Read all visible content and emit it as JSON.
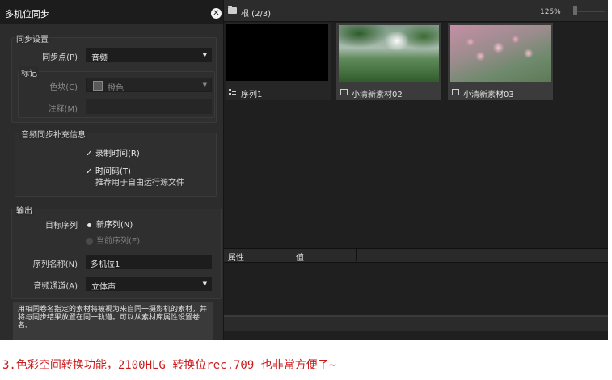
{
  "dialog": {
    "title": "多机位同步",
    "sync_settings": {
      "group_title": "同步设置",
      "sync_point_label": "同步点(P)",
      "sync_point_value": "音频",
      "marker_group_title": "标记",
      "color_label": "色块(C)",
      "color_value": "橙色",
      "comment_label": "注释(M)",
      "comment_value": ""
    },
    "audio_sync": {
      "group_title": "音频同步补充信息",
      "record_time_label": "录制时间(R)",
      "record_time_checked": true,
      "timecode_label": "时间码(T)",
      "timecode_checked": true,
      "timecode_note": "推荐用于自由运行源文件"
    },
    "output": {
      "group_title": "输出",
      "target_label": "目标序列",
      "option_new": "新序列(N)",
      "option_current": "当前序列(E)",
      "selected": "new",
      "seq_name_label": "序列名称(N)",
      "seq_name_value": "多机位1",
      "audio_channel_label": "音频通道(A)",
      "audio_channel_value": "立体声"
    },
    "help_text": "用相同卷名指定的素材将被视为来自同一摄影机的素材，并将与同步结果放置在同一轨道。可以从素材库属性设置卷名。"
  },
  "bin": {
    "path": "根 (2/3)",
    "zoom": "125%",
    "clips": [
      {
        "label": "序列1",
        "type": "sequence"
      },
      {
        "label": "小清新素材02",
        "type": "video"
      },
      {
        "label": "小清新素材03",
        "type": "video"
      }
    ]
  },
  "properties": {
    "col_attr": "属性",
    "col_value": "值"
  },
  "caption": "3.色彩空间转换功能，2100HLG 转换位rec.709 也非常方便了~",
  "colors": {
    "panel": "#2c2c2c",
    "workspace": "#1f1f1f",
    "caption": "#cc1a1a"
  }
}
